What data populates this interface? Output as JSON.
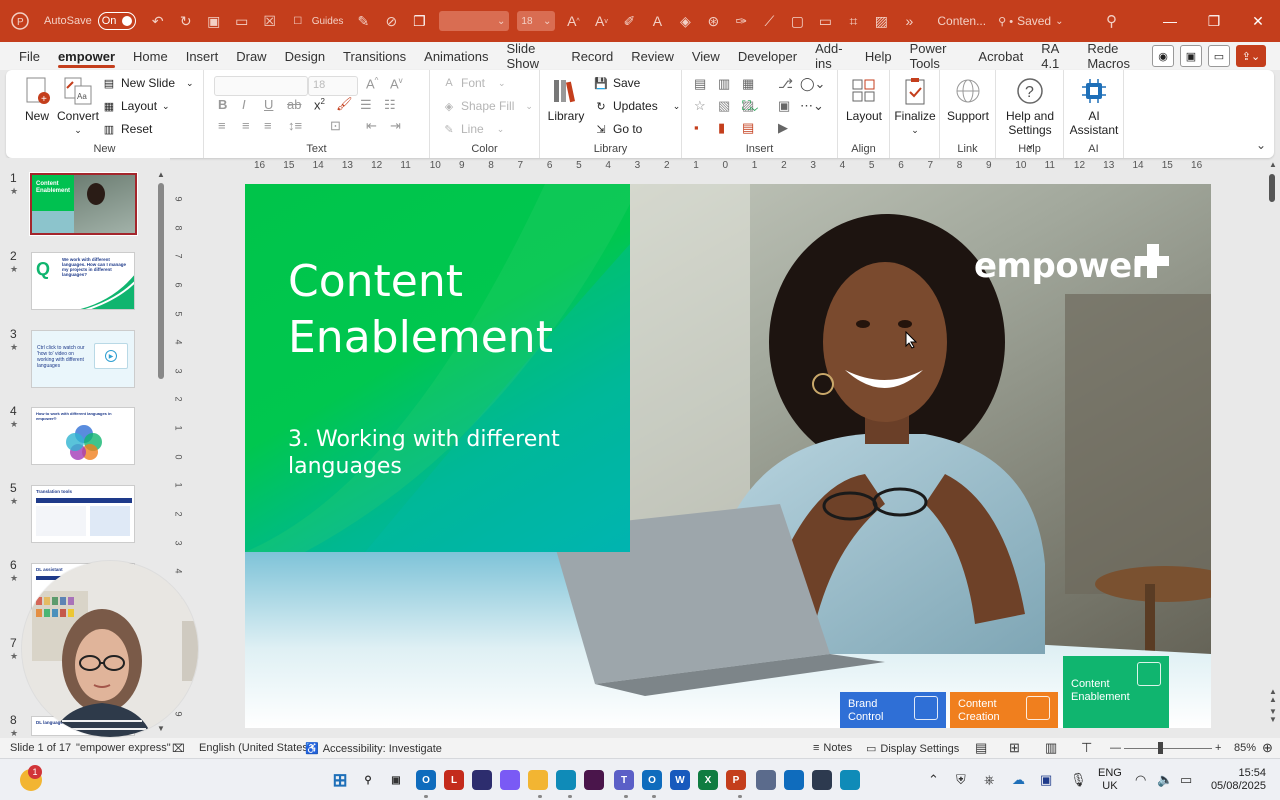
{
  "titlebar": {
    "autosave_label": "AutoSave",
    "autosave_state": "On",
    "guides_label": "Guides",
    "font_size_value": "18",
    "file_name": "Conten...",
    "save_status": "Saved",
    "accent_color": "#c43e1c"
  },
  "menu": {
    "tabs": [
      "File",
      "empower",
      "Home",
      "Insert",
      "Draw",
      "Design",
      "Transitions",
      "Animations",
      "Slide Show",
      "Record",
      "Review",
      "View",
      "Developer",
      "Add-ins",
      "Help",
      "Power Tools",
      "Acrobat",
      "RA 4.1",
      "Rede Macros"
    ],
    "active_tab": "empower"
  },
  "ribbon": {
    "new_group": {
      "label": "New",
      "new_button": "New",
      "convert_button": "Convert",
      "new_slide": "New Slide",
      "layout": "Layout",
      "reset": "Reset"
    },
    "text_group": {
      "label": "Text",
      "font_size": "18"
    },
    "color_group": {
      "label": "Color",
      "font": "Font",
      "shape_fill": "Shape Fill",
      "line": "Line"
    },
    "library_group": {
      "label": "Library",
      "library_button": "Library",
      "save": "Save",
      "updates": "Updates",
      "go_to": "Go to"
    },
    "insert_group": {
      "label": "Insert"
    },
    "align_group": {
      "label": "Align",
      "layout_button": "Layout"
    },
    "finalize_group": {
      "finalize_button": "Finalize"
    },
    "link_group": {
      "label": "Link",
      "support_button": "Support"
    },
    "help_group": {
      "label": "Help",
      "help_button_line1": "Help and",
      "help_button_line2": "Settings"
    },
    "ai_group": {
      "label": "AI",
      "ai_button_line1": "AI",
      "ai_button_line2": "Assistant"
    }
  },
  "thumbnails": {
    "numbers": [
      "1",
      "2",
      "3",
      "4",
      "5",
      "6",
      "7",
      "8"
    ],
    "slide1_title": "Content Enablement",
    "slide2_text": "We work with different languages. How can I manage my projects in different languages?",
    "slide2_letter": "Q",
    "slide3_text": "Ctrl click to watch our 'how to' video on working with different languages",
    "slide4_title": "How to work with different languages in empower®",
    "slide5_title": "Translation tools",
    "slide6_title": "DL assistant",
    "slide8_title": "DL language"
  },
  "ruler": {
    "h_ticks": [
      "16",
      "15",
      "14",
      "13",
      "12",
      "11",
      "10",
      "9",
      "8",
      "7",
      "6",
      "5",
      "4",
      "3",
      "2",
      "1",
      "0",
      "1",
      "2",
      "3",
      "4",
      "5",
      "6",
      "7",
      "8",
      "9",
      "10",
      "11",
      "12",
      "13",
      "14",
      "15",
      "16"
    ],
    "v_ticks": [
      "9",
      "8",
      "7",
      "6",
      "5",
      "4",
      "3",
      "2",
      "1",
      "0",
      "1",
      "2",
      "3",
      "4",
      "5",
      "6",
      "7",
      "8",
      "9"
    ]
  },
  "slide": {
    "title_line1": "Content",
    "title_line2": "Enablement",
    "subtitle": "3. Working with different languages",
    "logo_text": "empower",
    "tiles": [
      {
        "line1": "Brand",
        "line2": "Control",
        "color": "#2f6fd6"
      },
      {
        "line1": "Content",
        "line2": "Creation",
        "color": "#f07f1e"
      },
      {
        "line1": "Content",
        "line2": "Enablement",
        "color": "#10b56f"
      }
    ]
  },
  "statusbar": {
    "slide_counter": "Slide 1 of 17",
    "theme": "\"empower express\"",
    "language": "English (United States)",
    "accessibility": "Accessibility: Investigate",
    "notes": "Notes",
    "display_settings": "Display Settings",
    "zoom": "85%"
  },
  "taskbar": {
    "notification_badge": "1",
    "language_line1": "ENG",
    "language_line2": "UK",
    "time": "15:54",
    "date": "05/08/2025"
  }
}
